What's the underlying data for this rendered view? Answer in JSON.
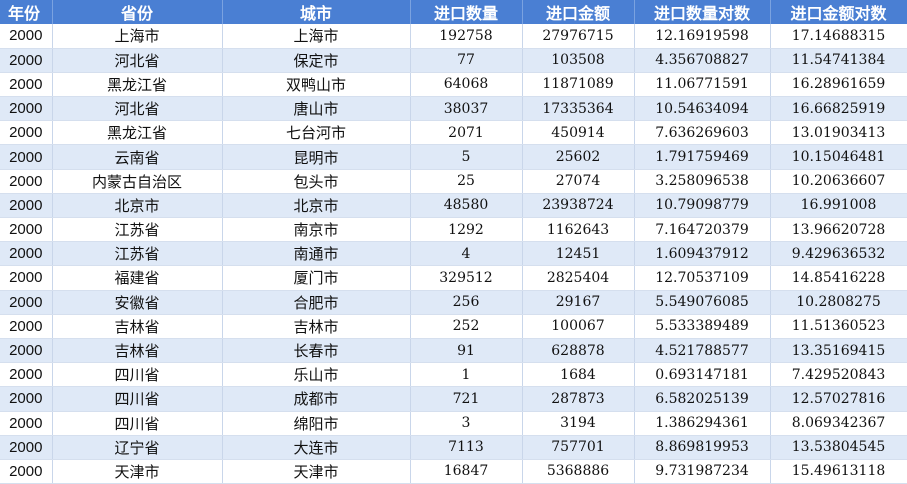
{
  "table": {
    "headers": [
      "年份",
      "省份",
      "城市",
      "进口数量",
      "进口金额",
      "进口数量对数",
      "进口金额对数"
    ],
    "rows": [
      [
        "2000",
        "上海市",
        "上海市",
        "192758",
        "27976715",
        "12.16919598",
        "17.14688315"
      ],
      [
        "2000",
        "河北省",
        "保定市",
        "77",
        "103508",
        "4.356708827",
        "11.54741384"
      ],
      [
        "2000",
        "黑龙江省",
        "双鸭山市",
        "64068",
        "11871089",
        "11.06771591",
        "16.28961659"
      ],
      [
        "2000",
        "河北省",
        "唐山市",
        "38037",
        "17335364",
        "10.54634094",
        "16.66825919"
      ],
      [
        "2000",
        "黑龙江省",
        "七台河市",
        "2071",
        "450914",
        "7.636269603",
        "13.01903413"
      ],
      [
        "2000",
        "云南省",
        "昆明市",
        "5",
        "25602",
        "1.791759469",
        "10.15046481"
      ],
      [
        "2000",
        "内蒙古自治区",
        "包头市",
        "25",
        "27074",
        "3.258096538",
        "10.20636607"
      ],
      [
        "2000",
        "北京市",
        "北京市",
        "48580",
        "23938724",
        "10.79098779",
        "16.991008"
      ],
      [
        "2000",
        "江苏省",
        "南京市",
        "1292",
        "1162643",
        "7.164720379",
        "13.96620728"
      ],
      [
        "2000",
        "江苏省",
        "南通市",
        "4",
        "12451",
        "1.609437912",
        "9.429636532"
      ],
      [
        "2000",
        "福建省",
        "厦门市",
        "329512",
        "2825404",
        "12.70537109",
        "14.85416228"
      ],
      [
        "2000",
        "安徽省",
        "合肥市",
        "256",
        "29167",
        "5.549076085",
        "10.2808275"
      ],
      [
        "2000",
        "吉林省",
        "吉林市",
        "252",
        "100067",
        "5.533389489",
        "11.51360523"
      ],
      [
        "2000",
        "吉林省",
        "长春市",
        "91",
        "628878",
        "4.521788577",
        "13.35169415"
      ],
      [
        "2000",
        "四川省",
        "乐山市",
        "1",
        "1684",
        "0.693147181",
        "7.429520843"
      ],
      [
        "2000",
        "四川省",
        "成都市",
        "721",
        "287873",
        "6.582025139",
        "12.57027816"
      ],
      [
        "2000",
        "四川省",
        "绵阳市",
        "3",
        "3194",
        "1.386294361",
        "8.069342367"
      ],
      [
        "2000",
        "辽宁省",
        "大连市",
        "7113",
        "757701",
        "8.869819953",
        "13.53804545"
      ],
      [
        "2000",
        "天津市",
        "天津市",
        "16847",
        "5368886",
        "9.731987234",
        "15.49613118"
      ]
    ]
  }
}
